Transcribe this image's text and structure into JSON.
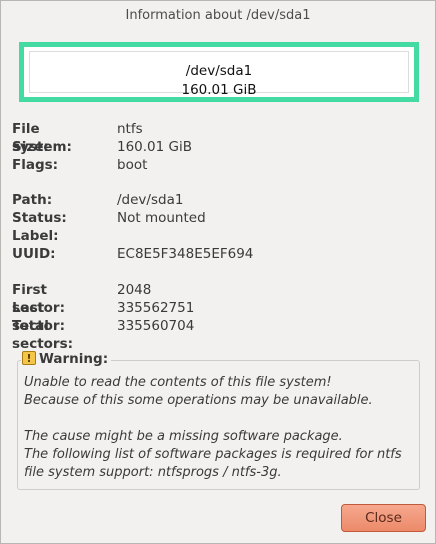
{
  "window": {
    "title": "Information about /dev/sda1"
  },
  "partition_graphic": {
    "path": "/dev/sda1",
    "size": "160.01 GiB",
    "border_color": "#43dba1"
  },
  "details_group1": [
    {
      "label": "File system:",
      "value": "ntfs"
    },
    {
      "label": "Size:",
      "value": "160.01 GiB"
    },
    {
      "label": "Flags:",
      "value": "boot"
    }
  ],
  "details_group2": [
    {
      "label": "Path:",
      "value": "/dev/sda1"
    },
    {
      "label": "Status:",
      "value": "Not mounted"
    },
    {
      "label": "Label:",
      "value": ""
    },
    {
      "label": "UUID:",
      "value": "EC8E5F348E5EF694"
    }
  ],
  "details_group3": [
    {
      "label": "First sector:",
      "value": "2048"
    },
    {
      "label": "Last sector:",
      "value": "335562751"
    },
    {
      "label": "Total sectors:",
      "value": "335560704"
    }
  ],
  "warning": {
    "title": "Warning:",
    "icon": "warning-icon",
    "lines": [
      "Unable to read the contents of this file system!",
      "Because of this some operations may be unavailable.",
      "",
      "The cause might be a missing software package.",
      "The following list of software packages is required for ntfs",
      "file system support:  ntfsprogs / ntfs-3g."
    ]
  },
  "buttons": {
    "close_label": "Close"
  }
}
